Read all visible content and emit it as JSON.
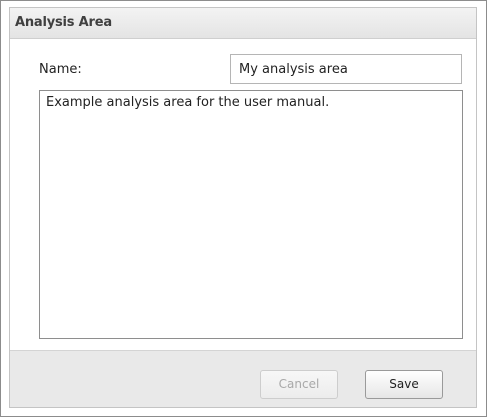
{
  "window": {
    "title": "Analysis Area"
  },
  "form": {
    "name_label": "Name:",
    "name_value": "My analysis area",
    "description_value": "Example analysis area for the user manual."
  },
  "footer": {
    "cancel_label": "Cancel",
    "cancel_disabled": true,
    "save_label": "Save"
  },
  "colors": {
    "panel_background": "#ececec",
    "title_text": "#404040",
    "disabled_text": "#a8a8a8"
  }
}
